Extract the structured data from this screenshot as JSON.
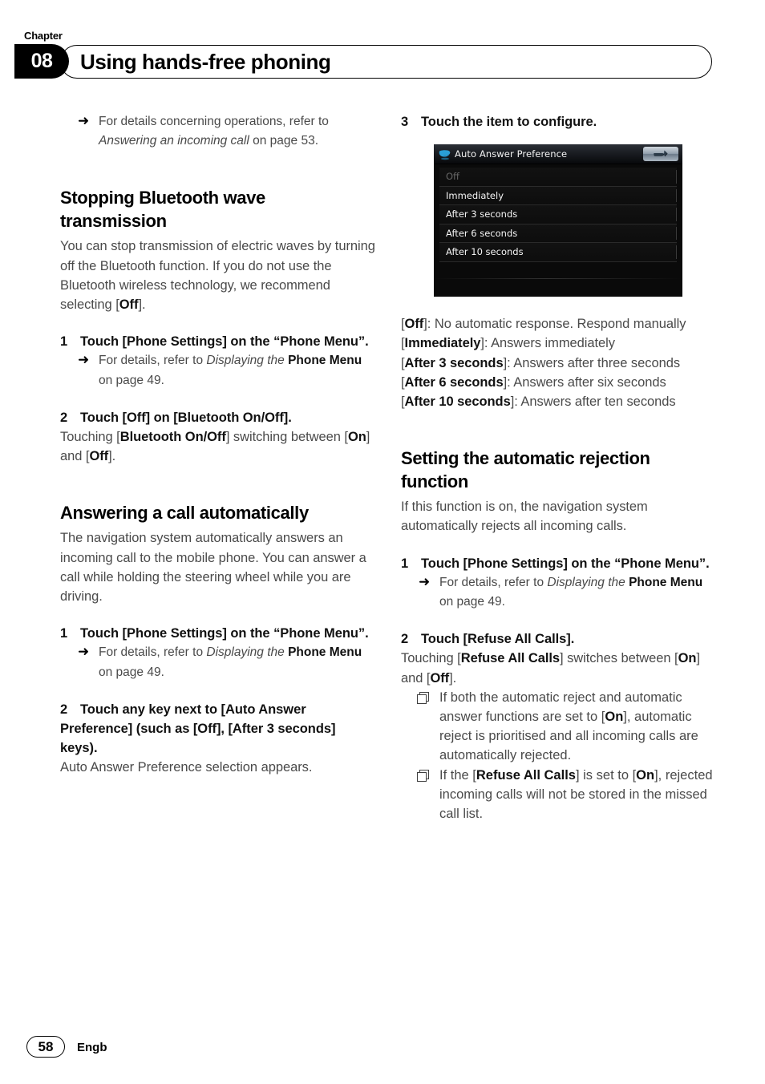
{
  "header": {
    "chapter_label": "Chapter",
    "chapter_number": "08",
    "title": "Using hands-free phoning"
  },
  "left_column": {
    "intro_note": {
      "marker": "arrow-bullet",
      "text_parts": [
        {
          "t": "For details concerning operations, refer to ",
          "style": "normal"
        },
        {
          "t": "Answering an incoming call",
          "style": "italic"
        },
        {
          "t": " on page 53.",
          "style": "normal"
        }
      ],
      "full_text": "For details concerning operations, refer to Answering an incoming call on page 53."
    },
    "section1": {
      "heading": "Stopping Bluetooth wave transmission",
      "body_before_off": "You can stop transmission of electric waves by turning off the Bluetooth function. If you do not use the Bluetooth wireless technology, we recommend selecting [",
      "body_off_bold": "Off",
      "body_after_off": "].",
      "step1": {
        "num": "1",
        "text": "Touch [Phone Settings] on the “Phone Menu”.",
        "note": {
          "prefix": "For details, refer to ",
          "italic": "Displaying the ",
          "bold": "Phone Menu",
          "suffix": " on page 49."
        }
      },
      "step2": {
        "num": "2",
        "text": "Touch [Off] on [Bluetooth On/Off].",
        "body_1": "Touching [",
        "body_bold_1": "Bluetooth On/Off",
        "body_2": "] switching between [",
        "body_bold_2": "On",
        "body_3": "] and [",
        "body_bold_3": "Off",
        "body_4": "]."
      }
    },
    "section2": {
      "heading": "Answering a call automatically",
      "body": "The navigation system automatically answers an incoming call to the mobile phone. You can answer a call while holding the steering wheel while you are driving.",
      "step1": {
        "num": "1",
        "text": "Touch [Phone Settings] on the “Phone Menu”.",
        "note": {
          "prefix": "For details, refer to ",
          "italic": "Displaying the ",
          "bold": "Phone Menu",
          "suffix": " on page 49."
        }
      },
      "step2": {
        "num": "2",
        "text": "Touch any key next to [Auto Answer Preference] (such as [Off], [After 3 seconds] keys).",
        "body": "Auto Answer Preference selection appears."
      }
    }
  },
  "right_column": {
    "step3": {
      "num": "3",
      "text": "Touch the item to configure."
    },
    "device_screen": {
      "title": "Auto Answer Preference",
      "logo_icon": "pioneer-logo-icon",
      "back_button_icon": "back-arrow-icon",
      "rows": [
        {
          "label": "Off",
          "state": "disabled"
        },
        {
          "label": "Immediately",
          "state": "enabled"
        },
        {
          "label": "After 3 seconds",
          "state": "enabled"
        },
        {
          "label": "After 6 seconds",
          "state": "enabled"
        },
        {
          "label": "After 10 seconds",
          "state": "enabled"
        }
      ],
      "colors": {
        "background": "#0a0a0a",
        "header_text": "#f2f2f2",
        "row_text": "#f4f4f4",
        "disabled_text": "#666666",
        "logo_blue": "#2a9fd6"
      }
    },
    "definitions": [
      {
        "term": "Off",
        "desc": ": No automatic response. Respond manually"
      },
      {
        "term": "Immediately",
        "desc": ": Answers immediately"
      },
      {
        "term": "After 3 seconds",
        "desc": ": Answers after three seconds"
      },
      {
        "term": "After 6 seconds",
        "desc": ": Answers after six seconds"
      },
      {
        "term": "After 10 seconds",
        "desc": ": Answers after ten seconds"
      }
    ],
    "section3": {
      "heading": "Setting the automatic rejection function",
      "body": "If this function is on, the navigation system automatically rejects all incoming calls.",
      "step1": {
        "num": "1",
        "text": "Touch [Phone Settings] on the “Phone Menu”.",
        "note": {
          "prefix": "For details, refer to ",
          "italic": "Displaying the ",
          "bold": "Phone Menu",
          "suffix": " on page 49."
        }
      },
      "step2": {
        "num": "2",
        "text": "Touch [Refuse All Calls].",
        "body_1": "Touching [",
        "body_bold_1": "Refuse All Calls",
        "body_2": "] switches between [",
        "body_bold_2": "On",
        "body_3": "] and [",
        "body_bold_3": "Off",
        "body_4": "].",
        "notes": [
          {
            "p1": "If both the automatic reject and automatic answer functions are set to [",
            "b1": "On",
            "p2": "], automatic reject is prioritised and all incoming calls are automatically rejected."
          },
          {
            "p1": "If the [",
            "b1": "Refuse All Calls",
            "p2": "] is set to [",
            "b2": "On",
            "p3": "], rejected incoming calls will not be stored in the missed call list."
          }
        ]
      }
    }
  },
  "footer": {
    "page_number": "58",
    "language_code": "Engb"
  }
}
